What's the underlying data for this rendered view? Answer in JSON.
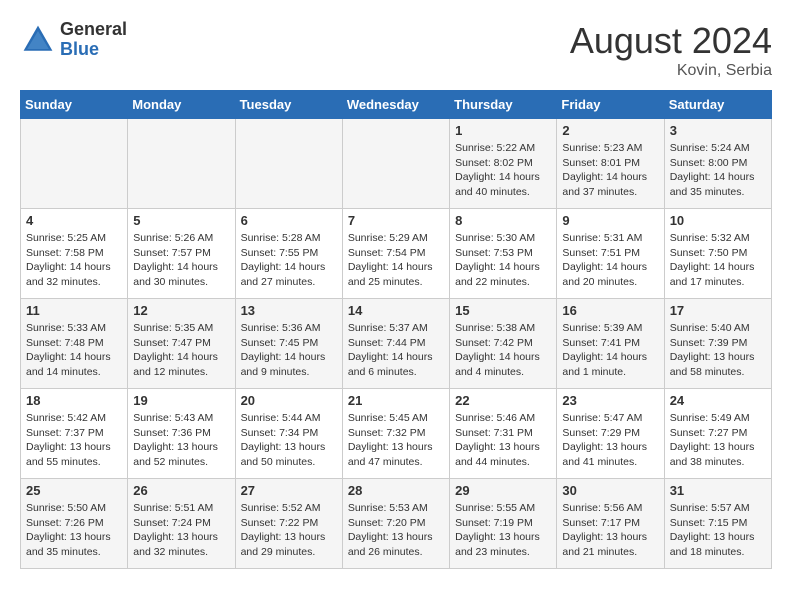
{
  "header": {
    "logo_line1": "General",
    "logo_line2": "Blue",
    "month_year": "August 2024",
    "location": "Kovin, Serbia"
  },
  "days_of_week": [
    "Sunday",
    "Monday",
    "Tuesday",
    "Wednesday",
    "Thursday",
    "Friday",
    "Saturday"
  ],
  "weeks": [
    [
      {
        "day": "",
        "content": ""
      },
      {
        "day": "",
        "content": ""
      },
      {
        "day": "",
        "content": ""
      },
      {
        "day": "",
        "content": ""
      },
      {
        "day": "1",
        "content": "Sunrise: 5:22 AM\nSunset: 8:02 PM\nDaylight: 14 hours\nand 40 minutes."
      },
      {
        "day": "2",
        "content": "Sunrise: 5:23 AM\nSunset: 8:01 PM\nDaylight: 14 hours\nand 37 minutes."
      },
      {
        "day": "3",
        "content": "Sunrise: 5:24 AM\nSunset: 8:00 PM\nDaylight: 14 hours\nand 35 minutes."
      }
    ],
    [
      {
        "day": "4",
        "content": "Sunrise: 5:25 AM\nSunset: 7:58 PM\nDaylight: 14 hours\nand 32 minutes."
      },
      {
        "day": "5",
        "content": "Sunrise: 5:26 AM\nSunset: 7:57 PM\nDaylight: 14 hours\nand 30 minutes."
      },
      {
        "day": "6",
        "content": "Sunrise: 5:28 AM\nSunset: 7:55 PM\nDaylight: 14 hours\nand 27 minutes."
      },
      {
        "day": "7",
        "content": "Sunrise: 5:29 AM\nSunset: 7:54 PM\nDaylight: 14 hours\nand 25 minutes."
      },
      {
        "day": "8",
        "content": "Sunrise: 5:30 AM\nSunset: 7:53 PM\nDaylight: 14 hours\nand 22 minutes."
      },
      {
        "day": "9",
        "content": "Sunrise: 5:31 AM\nSunset: 7:51 PM\nDaylight: 14 hours\nand 20 minutes."
      },
      {
        "day": "10",
        "content": "Sunrise: 5:32 AM\nSunset: 7:50 PM\nDaylight: 14 hours\nand 17 minutes."
      }
    ],
    [
      {
        "day": "11",
        "content": "Sunrise: 5:33 AM\nSunset: 7:48 PM\nDaylight: 14 hours\nand 14 minutes."
      },
      {
        "day": "12",
        "content": "Sunrise: 5:35 AM\nSunset: 7:47 PM\nDaylight: 14 hours\nand 12 minutes."
      },
      {
        "day": "13",
        "content": "Sunrise: 5:36 AM\nSunset: 7:45 PM\nDaylight: 14 hours\nand 9 minutes."
      },
      {
        "day": "14",
        "content": "Sunrise: 5:37 AM\nSunset: 7:44 PM\nDaylight: 14 hours\nand 6 minutes."
      },
      {
        "day": "15",
        "content": "Sunrise: 5:38 AM\nSunset: 7:42 PM\nDaylight: 14 hours\nand 4 minutes."
      },
      {
        "day": "16",
        "content": "Sunrise: 5:39 AM\nSunset: 7:41 PM\nDaylight: 14 hours\nand 1 minute."
      },
      {
        "day": "17",
        "content": "Sunrise: 5:40 AM\nSunset: 7:39 PM\nDaylight: 13 hours\nand 58 minutes."
      }
    ],
    [
      {
        "day": "18",
        "content": "Sunrise: 5:42 AM\nSunset: 7:37 PM\nDaylight: 13 hours\nand 55 minutes."
      },
      {
        "day": "19",
        "content": "Sunrise: 5:43 AM\nSunset: 7:36 PM\nDaylight: 13 hours\nand 52 minutes."
      },
      {
        "day": "20",
        "content": "Sunrise: 5:44 AM\nSunset: 7:34 PM\nDaylight: 13 hours\nand 50 minutes."
      },
      {
        "day": "21",
        "content": "Sunrise: 5:45 AM\nSunset: 7:32 PM\nDaylight: 13 hours\nand 47 minutes."
      },
      {
        "day": "22",
        "content": "Sunrise: 5:46 AM\nSunset: 7:31 PM\nDaylight: 13 hours\nand 44 minutes."
      },
      {
        "day": "23",
        "content": "Sunrise: 5:47 AM\nSunset: 7:29 PM\nDaylight: 13 hours\nand 41 minutes."
      },
      {
        "day": "24",
        "content": "Sunrise: 5:49 AM\nSunset: 7:27 PM\nDaylight: 13 hours\nand 38 minutes."
      }
    ],
    [
      {
        "day": "25",
        "content": "Sunrise: 5:50 AM\nSunset: 7:26 PM\nDaylight: 13 hours\nand 35 minutes."
      },
      {
        "day": "26",
        "content": "Sunrise: 5:51 AM\nSunset: 7:24 PM\nDaylight: 13 hours\nand 32 minutes."
      },
      {
        "day": "27",
        "content": "Sunrise: 5:52 AM\nSunset: 7:22 PM\nDaylight: 13 hours\nand 29 minutes."
      },
      {
        "day": "28",
        "content": "Sunrise: 5:53 AM\nSunset: 7:20 PM\nDaylight: 13 hours\nand 26 minutes."
      },
      {
        "day": "29",
        "content": "Sunrise: 5:55 AM\nSunset: 7:19 PM\nDaylight: 13 hours\nand 23 minutes."
      },
      {
        "day": "30",
        "content": "Sunrise: 5:56 AM\nSunset: 7:17 PM\nDaylight: 13 hours\nand 21 minutes."
      },
      {
        "day": "31",
        "content": "Sunrise: 5:57 AM\nSunset: 7:15 PM\nDaylight: 13 hours\nand 18 minutes."
      }
    ]
  ]
}
